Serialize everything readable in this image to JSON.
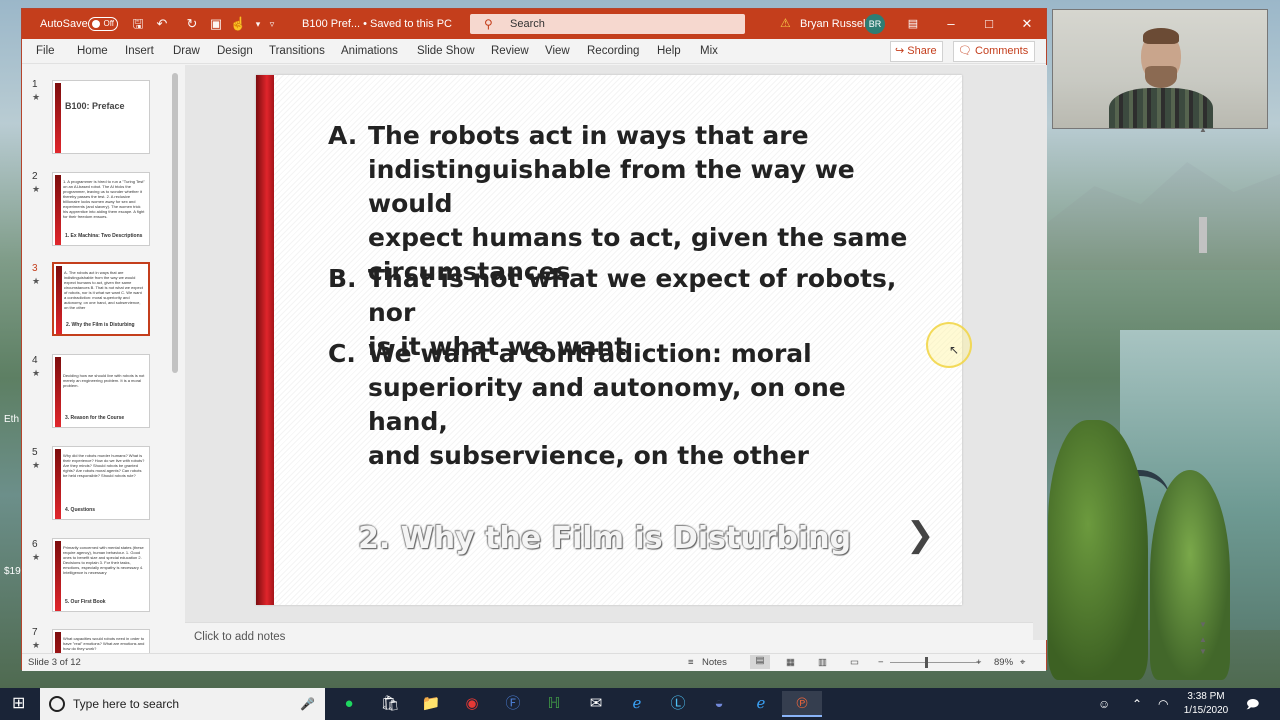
{
  "desktop": {
    "left_label_1": "Eth",
    "left_label_2": "$19"
  },
  "titlebar": {
    "autosave_label": "AutoSave",
    "autosave_state": "Off",
    "document_title": "B100 Pref...  •  Saved to this PC",
    "search_placeholder": "Search",
    "user_name": "Bryan Russell",
    "user_initials": "BR"
  },
  "menu": {
    "items": [
      "File",
      "Home",
      "Insert",
      "Draw",
      "Design",
      "Transitions",
      "Animations",
      "Slide Show",
      "Review",
      "View",
      "Recording",
      "Help",
      "Mix"
    ],
    "share": "Share",
    "comments": "Comments"
  },
  "thumbnails": [
    {
      "num": "1",
      "title": "B100: Preface",
      "text": "",
      "footer": ""
    },
    {
      "num": "2",
      "title": "",
      "text": "1. A programmer is hired to run a \"Turing Test\" on an AI-based robot. The AI tricks the programmer, leaving us to wonder whether it thereby passes the test. 2. A reclusive billionaire locks women away for sex and experiments (and slavery). The women trick his apprentice into aiding them escape. A fight for their freedom ensues.",
      "footer": "1. Ex Machina: Two Descriptions"
    },
    {
      "num": "3",
      "title": "",
      "text": "A. The robots act in ways that are indistinguishable from the way we would expect humans to act, given the same circumstances B. That is not what we expect of robots, nor is it what we want C. We want a contradiction: moral superiority and autonomy, on one hand, and subservience, on the other",
      "footer": "2. Why the Film is Disturbing"
    },
    {
      "num": "4",
      "title": "",
      "text": "Deciding how we should live with robots is not merely an engineering problem. It is a moral problem.",
      "footer": "3. Reason for the Course"
    },
    {
      "num": "5",
      "title": "",
      "text": "Why did the robots murder humans? What is their experience? How do we live with robots? Are they minds? Should robots be granted rights? Are robots moral agents? Can robots be held responsible? Should robots rule?",
      "footer": "4. Questions"
    },
    {
      "num": "6",
      "title": "",
      "text": "Primarily concerned with mental states (these require agency), human behaviour. 1. Good ones to benefit size and special education 2. Decisions to explain 3. For their tasks, emotions, especially empathy is necessary 4. Intelligence is necessary",
      "footer": "5. Our First Book"
    },
    {
      "num": "7",
      "title": "",
      "text": "What capacities would robots need in order to have \"real\" emotions? What are emotions and how do they work?",
      "footer": ""
    }
  ],
  "slide": {
    "bullets": [
      {
        "letter": "A.",
        "lines": [
          "The robots act in ways that are",
          "indistinguishable from the way we would",
          "expect humans to act, given the same",
          "circumstances"
        ]
      },
      {
        "letter": "B.",
        "lines": [
          "That is not what we expect of robots, nor",
          "is it what we want"
        ]
      },
      {
        "letter": "C.",
        "lines": [
          "We want a contradiction: moral",
          "superiority and autonomy, on one hand,",
          "and subservience, on the other"
        ]
      }
    ],
    "footer_title": "2. Why the Film is Disturbing",
    "next_glyph": "❯"
  },
  "notes_placeholder": "Click to add notes",
  "status": {
    "slide_info": "Slide 3 of 12",
    "notes_label": "Notes",
    "zoom": "89%"
  },
  "taskbar": {
    "search_placeholder": "Type here to search",
    "time": "3:38 PM",
    "date": "1/15/2020"
  },
  "colors": {
    "ppt_accent": "#c43e1c",
    "slide_bar": "#e0252b",
    "taskbar": "#1a2437"
  }
}
